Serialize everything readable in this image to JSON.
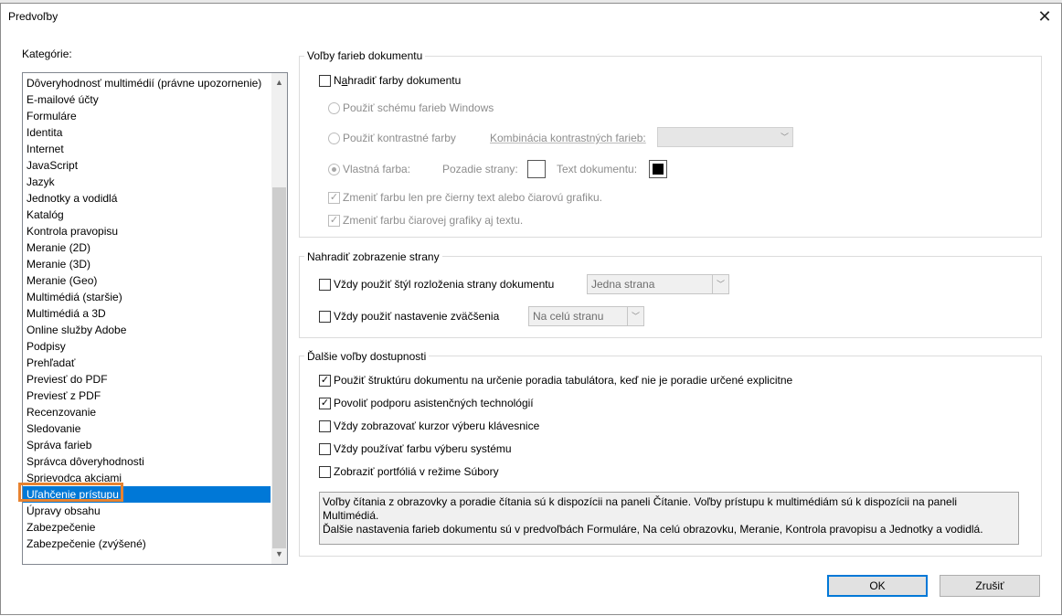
{
  "window": {
    "title": "Predvoľby",
    "close_glyph": "✕"
  },
  "categories": {
    "label": "Kategórie:",
    "items": [
      "Dôveryhodnosť multimédií (právne upozornenie)",
      "E-mailové účty",
      "Formuláre",
      "Identita",
      "Internet",
      "JavaScript",
      "Jazyk",
      "Jednotky a vodidlá",
      "Katalóg",
      "Kontrola pravopisu",
      "Meranie (2D)",
      "Meranie (3D)",
      "Meranie (Geo)",
      "Multimédiá (staršie)",
      "Multimédiá a 3D",
      "Online služby Adobe",
      "Podpisy",
      "Prehľadať",
      "Previesť do PDF",
      "Previesť z PDF",
      "Recenzovanie",
      "Sledovanie",
      "Správa farieb",
      "Správca dôveryhodnosti",
      "Sprievodca akciami",
      "Uľahčenie prístupu",
      "Úpravy obsahu",
      "Zabezpečenie",
      "Zabezpečenie (zvýšené)"
    ],
    "selected_index": 25
  },
  "doc_colors": {
    "legend": "Voľby farieb dokumentu",
    "replace_pre": "N",
    "replace_under": "a",
    "replace_post": "hradiť farby dokumentu",
    "replace_checked": false,
    "windows_scheme": "Použiť schému farieb Windows",
    "contrast_colors": "Použiť kontrastné farby",
    "contrast_combo_label": "Kombinácia kontrastných farieb:",
    "custom_color": "Vlastná farba:",
    "page_bg_label": "Pozadie strany:",
    "doc_text_label": "Text dokumentu:",
    "page_bg_color": "#ffffff",
    "doc_text_color": "#000000",
    "change_black_text": "Zmeniť farbu len pre čierny text alebo čiarovú grafiku.",
    "change_line_art": "Zmeniť farbu čiarovej grafiky aj textu.",
    "check_glyph": "✓"
  },
  "page_display": {
    "legend": "Nahradiť zobrazenie strany",
    "layout_label": "Vždy použiť štýl rozloženia strany dokumentu",
    "layout_value": "Jedna strana",
    "zoom_label": "Vždy použiť nastavenie zväčšenia",
    "zoom_value": "Na celú stranu",
    "dropdown_glyph": "﹀"
  },
  "accessibility": {
    "legend": "Ďalšie voľby dostupnosti",
    "options": [
      {
        "label": "Použiť štruktúru dokumentu na určenie poradia tabulátora, keď nie je poradie určené explicitne",
        "checked": true
      },
      {
        "label": "Povoliť podporu asistenčných technológií",
        "checked": true
      },
      {
        "label": "Vždy zobrazovať kurzor výberu klávesnice",
        "checked": false
      },
      {
        "label": "Vždy používať farbu výberu systému",
        "checked": false
      },
      {
        "label": "Zobraziť portfóliá v režime Súbory",
        "checked": false
      }
    ],
    "info_line1": "Voľby čítania z obrazovky a poradie čítania sú k dispozícii na paneli Čítanie. Voľby prístupu k multimédiám sú k dispozícii na paneli Multimédiá.",
    "info_line2": "Ďalšie nastavenia farieb dokumentu sú v predvoľbách Formuláre, Na celú obrazovku, Meranie, Kontrola pravopisu a Jednotky a vodidlá."
  },
  "buttons": {
    "ok": "OK",
    "cancel": "Zrušiť"
  },
  "accent": {
    "selection": "#0078d7",
    "highlight": "#e8822f"
  }
}
